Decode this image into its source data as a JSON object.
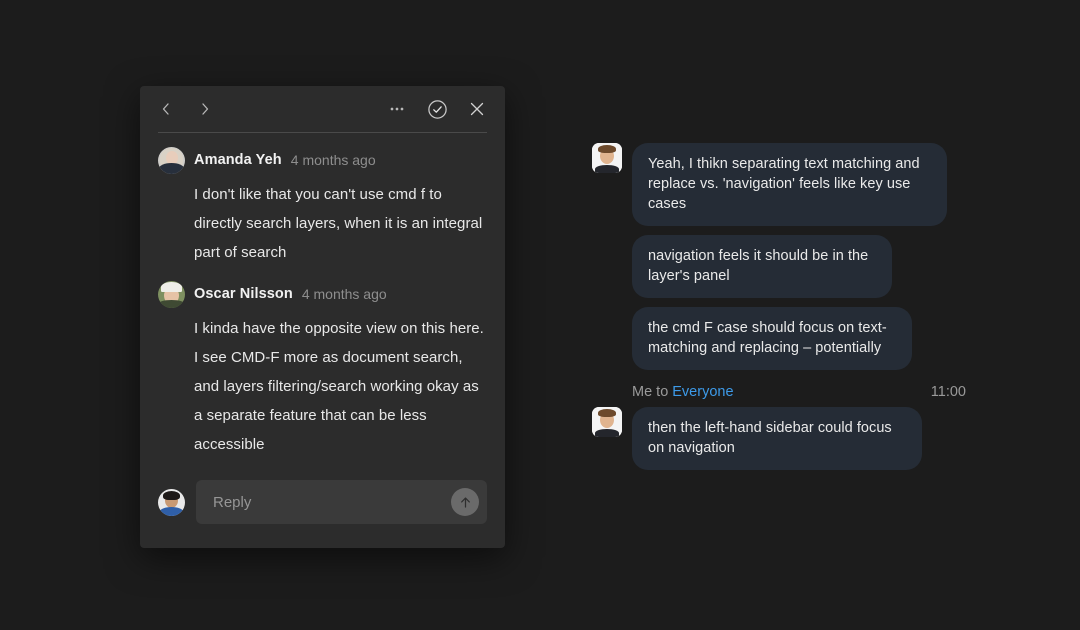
{
  "background_color": "#1c1c1c",
  "comment_panel": {
    "background_color": "#2c2c2c",
    "header": {
      "prev_label": "‹",
      "next_label": "›",
      "icons": [
        {
          "name": "chevron-left-icon",
          "label": "Previous comment"
        },
        {
          "name": "chevron-right-icon",
          "label": "Next comment"
        },
        {
          "name": "more-options-icon",
          "label": "More options"
        },
        {
          "name": "resolve-check-icon",
          "label": "Mark as resolved"
        },
        {
          "name": "close-icon",
          "label": "Close"
        }
      ]
    },
    "comments": [
      {
        "author": "Amanda Yeh",
        "timestamp": "4 months ago",
        "text": "I don't like that you can't use cmd f to directly search layers, when it is an integral part of search"
      },
      {
        "author": "Oscar Nilsson",
        "timestamp": "4 months ago",
        "text": "I kinda have the opposite view on this here. I see CMD-F more as document search, and layers filtering/search working okay as a separate feature that can be less accessible"
      }
    ],
    "reply": {
      "placeholder": "Reply",
      "value": "",
      "send_icon": "arrow-up-icon"
    }
  },
  "chat": {
    "bubble_color": "#252c36",
    "accent_color": "#3d9ae8",
    "messages": [
      {
        "text": "Yeah, I thikn separating text matching and replace vs. 'navigation' feels like key use cases",
        "has_avatar": true
      },
      {
        "text": "navigation feels it should be in the layer's panel",
        "has_avatar": false
      },
      {
        "text": "the cmd F case should focus on text-matching and replacing – potentially",
        "has_avatar": false
      }
    ],
    "meta": {
      "sender": "Me to",
      "recipient": "Everyone",
      "time": "11:00"
    },
    "last_message": {
      "text": "then the left-hand sidebar could focus on navigation",
      "has_avatar": true
    }
  }
}
